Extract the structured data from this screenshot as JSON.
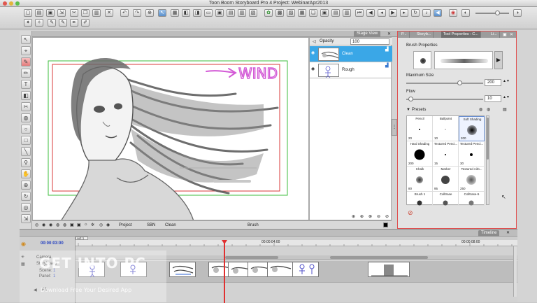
{
  "window": {
    "title": "Toon Boom Storyboard Pro 4 Project: WebinarApr2013"
  },
  "stage": {
    "tab_label": "Stage View",
    "annotation_text": "WIND"
  },
  "layers": {
    "opacity_label": "Opacity",
    "opacity_value": "100",
    "items": [
      {
        "name": "Clean",
        "selected": true
      },
      {
        "name": "Rough",
        "selected": false
      }
    ]
  },
  "stage_bottom": {
    "project_label": "Project",
    "angle_value": "SBN",
    "layer_label": "Clean",
    "tool_label": "Brush"
  },
  "tool_properties": {
    "tabs": [
      "P...",
      "Storyb...",
      "Tool Properties : C...",
      "Li..."
    ],
    "brush_properties_label": "Brush Properties",
    "maximum_size_label": "Maximum Size",
    "maximum_size_value": "200",
    "maximum_size_level": 0.7,
    "flow_label": "Flow",
    "flow_value": "10",
    "flow_level": 0.06,
    "presets_label": "Presets",
    "presets": [
      {
        "name": "Pencil",
        "size": "20"
      },
      {
        "name": "Ballpoint",
        "size": "10"
      },
      {
        "name": "Soft Shading",
        "size": "200"
      },
      {
        "name": "Hard Shading",
        "size": "200"
      },
      {
        "name": "Textured Penci...",
        "size": "15"
      },
      {
        "name": "Textured Penci...",
        "size": "30"
      },
      {
        "name": "Chalk",
        "size": "80"
      },
      {
        "name": "Marker",
        "size": "95"
      },
      {
        "name": "Textured Airb...",
        "size": "250"
      },
      {
        "name": "Brush 1",
        "size": ""
      },
      {
        "name": "Colltrase",
        "size": ""
      },
      {
        "name": "Colltrase-5",
        "size": ""
      }
    ]
  },
  "timeline": {
    "tab_label": "Timeline",
    "timecode": "00:00:03:00",
    "act_label": "Act 1",
    "ruler_marks": [
      "00:00:04:00",
      "00:00:08:00"
    ],
    "camera_label": "Camera",
    "storyboard_label": "Storyboard",
    "scene_label": "Scene:",
    "scene_value": "1",
    "panel_label": "Panel:",
    "panel_value": "1",
    "audio_label": "A1"
  },
  "watermark": {
    "main": "GET INTO PC",
    "sub": "Download Free Your Desired App"
  },
  "colors": {
    "accent_blue": "#3aa7e7",
    "playhead": "#e03030",
    "props_border": "#e05050",
    "safe_frame": "#3dbd3d",
    "camera_frame": "#d83a3a",
    "annotation_pink": "#d35ad6"
  }
}
